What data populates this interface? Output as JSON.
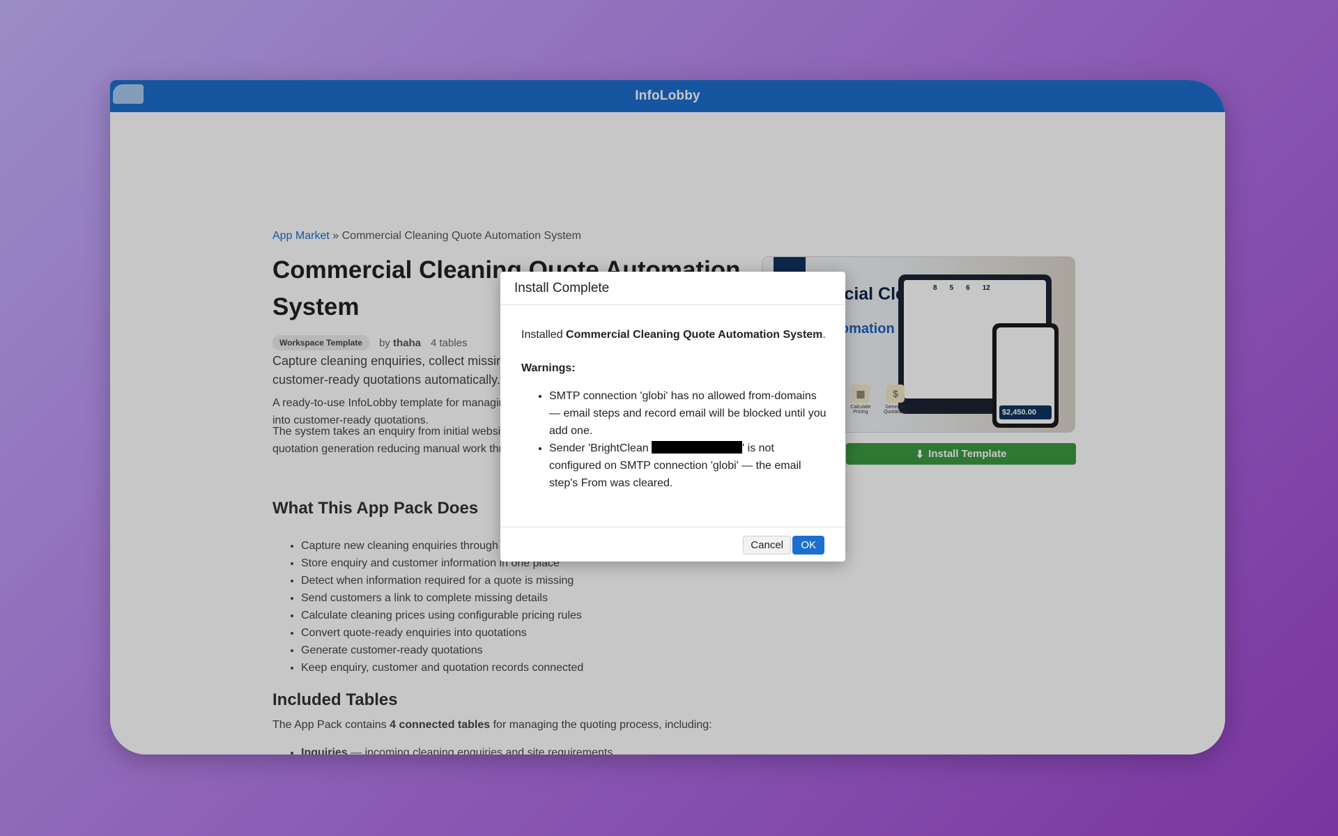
{
  "window": {
    "title": "InfoLobby"
  },
  "page": {
    "breadcrumb_link": "App Market",
    "breadcrumb_sep": "»",
    "breadcrumb_current": "Commercial Cleaning Quote Automation System",
    "title": "Commercial Cleaning Quote Automation System",
    "badge": "Workspace Template",
    "by_label": "by",
    "author": "thaha",
    "table_count": "4 tables",
    "lead": "Capture cleaning enquiries, collect missing information and generate customer-ready quotations automatically.",
    "paragraph1": "A ready-to-use InfoLobby template for managing cleaning enquiries and turning them into customer-ready quotations.",
    "paragraph2": "The system takes an enquiry from initial website submission through to pricing and quotation generation reducing manual work throughout the quoting process.",
    "section1_title": "What This App Pack Does",
    "features": [
      "Capture new cleaning enquiries through an online form",
      "Store enquiry and customer information in one place",
      "Detect when information required for a quote is missing",
      "Send customers a link to complete missing details",
      "Calculate cleaning prices using configurable pricing rules",
      "Convert quote-ready enquiries into quotations",
      "Generate customer-ready quotations",
      "Keep enquiry, customer and quotation records connected"
    ],
    "section2_title": "Included Tables",
    "tables_intro_pre": "The App Pack contains",
    "tables_intro_bold": "4 connected tables",
    "tables_intro_post": "for managing the quoting process, including:",
    "tables": [
      {
        "name": "Inquiries",
        "desc": "— incoming cleaning enquiries and site requirements"
      }
    ],
    "install_button": "Install Template"
  },
  "promo": {
    "line1": "Commercial Cleaning",
    "line2": "Quote Automation System",
    "stats": [
      "8",
      "5",
      "6",
      "12"
    ],
    "price": "$2,450.00",
    "feature1": "Calculate Pricing",
    "feature2": "Generate Quotations"
  },
  "modal": {
    "title": "Install Complete",
    "installed_pre": "Installed",
    "installed_name": "Commercial Cleaning Quote Automation System",
    "installed_post": ".",
    "warnings_label": "Warnings:",
    "warning1": "SMTP connection 'globi' has no allowed from-domains — email steps and record email will be blocked until you add one.",
    "warning2_pre": "Sender 'BrightClean",
    "warning2_post": "' is not configured on SMTP connection 'globi' — the email step's From was cleared.",
    "cancel": "Cancel",
    "ok": "OK"
  },
  "colors": {
    "titlebar": "#1d6fcf",
    "install_button": "#3b9a43",
    "ok_button": "#1d6fcf",
    "link": "#1d6fcf"
  }
}
